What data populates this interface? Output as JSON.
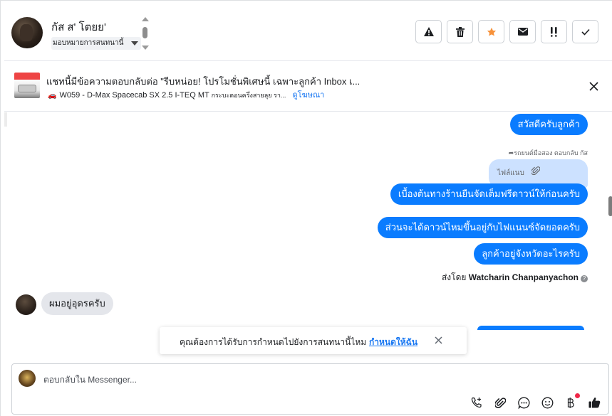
{
  "header": {
    "contact_name": "กัส ส' โตยย'",
    "assign_label": "มอบหมายการสนทนานี้",
    "actions": [
      {
        "name": "spam-warning-button",
        "icon": "warning-icon"
      },
      {
        "name": "delete-button",
        "icon": "trash-icon"
      },
      {
        "name": "star-button",
        "icon": "star-icon",
        "color": "#f7923b"
      },
      {
        "name": "mark-unread-button",
        "icon": "envelope-icon"
      },
      {
        "name": "follow-up-button",
        "icon": "follow-up-icon"
      },
      {
        "name": "mark-done-button",
        "icon": "check-icon"
      }
    ]
  },
  "ad": {
    "title": "แชทนี้มีข้อความตอบกลับต่อ \"รีบหน่อย! โปรโมชั่นพิเศษนี้ เฉพาะลูกค้า Inbox เ...",
    "subtitle": "W059 - D-Max Spacecab SX 2.5 I-TEQ MT",
    "subtitle_extra": "กระบะตอนครึ่งสายลุย รา...",
    "link": "ดูโฆษณา"
  },
  "chat": {
    "messages_out_top": "สวัสดีครับลูกค้า",
    "reply_note": "รถยนต์มือสอง ตอบกลับ กัส",
    "attachment_label": "ไฟล์แนบ",
    "message_1": "เบื้องต้นทางร้านยืนจัดเต็มฟรีดาวน์ให้ก่อนครับ",
    "message_2": "ส่วนจะได้ดาวน์ไหมขึ้นอยู่กับไฟแนนซ์จัดยอดครับ",
    "message_3": "ลูกค้าอยู่จังหวัดอะไรครับ",
    "sent_by_prefix": "ส่งโดย",
    "sent_by_name": "Watcharin Chanpanyachon",
    "incoming": "ผมอยู่อุดรครับ"
  },
  "toast": {
    "message": "คุณต้องการได้รับการกำหนดไปยังการสนทนานี้ไหม",
    "action": "กำหนดให้ฉัน"
  },
  "composer": {
    "placeholder": "ตอบกลับใน Messenger...",
    "tools": [
      "add-contact-icon",
      "paperclip-icon",
      "saved-reply-icon",
      "emoji-icon",
      "baht-icon",
      "thumbs-up-icon"
    ],
    "accent": "#1877f2"
  }
}
